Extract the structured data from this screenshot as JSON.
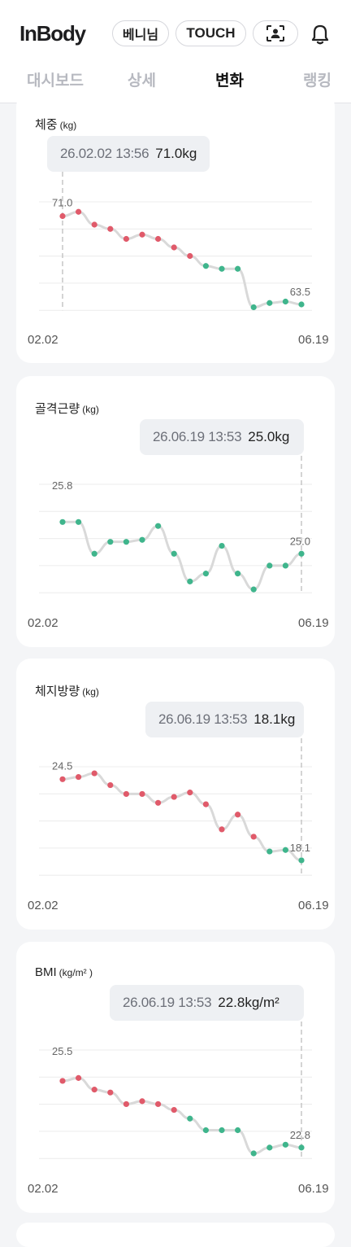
{
  "header": {
    "logo": "InBody",
    "user_label": "베니님",
    "touch_label": "TOUCH",
    "scan_icon": "face-scan-icon",
    "bell_icon": "bell-icon"
  },
  "tabs": [
    {
      "label": "대시보드",
      "active": false
    },
    {
      "label": "상세",
      "active": false
    },
    {
      "label": "변화",
      "active": true
    },
    {
      "label": "랭킹",
      "active": false
    }
  ],
  "colors": {
    "increase": "#e05a6a",
    "decrease": "#3fb58c",
    "line": "#d9d9d9",
    "accent": "#111111"
  },
  "chart_data": [
    {
      "type": "line",
      "title": "체중",
      "unit": "(kg)",
      "x_start": "02.02",
      "x_end": "06.19",
      "tooltip": {
        "date": "26.02.02 13:56",
        "value": "71.0kg"
      },
      "selected_index": 0,
      "label_first": "71.0",
      "label_last": "63.5",
      "ylim": [
        63.4,
        71.0
      ],
      "values": [
        70.0,
        70.3,
        69.4,
        69.1,
        68.4,
        68.7,
        68.4,
        67.8,
        67.2,
        66.5,
        66.3,
        66.3,
        63.6,
        63.9,
        64.0,
        63.8
      ],
      "point_colors": [
        "increase",
        "increase",
        "increase",
        "increase",
        "increase",
        "increase",
        "increase",
        "increase",
        "increase",
        "decrease",
        "decrease",
        "decrease",
        "decrease",
        "decrease",
        "decrease",
        "decrease"
      ]
    },
    {
      "type": "line",
      "title": "골격근량",
      "unit": "(kg)",
      "x_start": "02.02",
      "x_end": "06.19",
      "tooltip": {
        "date": "26.06.19 13:53",
        "value": "25.0kg"
      },
      "selected_index": 15,
      "label_first": "25.8",
      "label_last": "25.0",
      "ylim": [
        24.0,
        25.95
      ],
      "values": [
        25.8,
        25.8,
        25.0,
        25.3,
        25.3,
        25.35,
        25.7,
        25.0,
        24.3,
        24.5,
        25.2,
        24.5,
        24.1,
        24.7,
        24.7,
        25.0
      ],
      "point_colors": [
        "decrease",
        "decrease",
        "decrease",
        "decrease",
        "decrease",
        "decrease",
        "decrease",
        "decrease",
        "decrease",
        "decrease",
        "decrease",
        "decrease",
        "decrease",
        "decrease",
        "decrease",
        "decrease"
      ]
    },
    {
      "type": "line",
      "title": "체지방량",
      "unit": "(kg)",
      "x_start": "02.02",
      "x_end": "06.19",
      "tooltip": {
        "date": "26.06.19 13:53",
        "value": "18.1kg"
      },
      "selected_index": 15,
      "label_first": "24.5",
      "label_last": "18.1",
      "ylim": [
        17.6,
        24.5
      ],
      "values": [
        23.6,
        23.75,
        24.0,
        23.2,
        22.6,
        22.6,
        22.0,
        22.4,
        22.7,
        21.9,
        20.2,
        21.2,
        19.7,
        18.7,
        18.8,
        18.1
      ],
      "point_colors": [
        "increase",
        "increase",
        "increase",
        "increase",
        "increase",
        "increase",
        "increase",
        "increase",
        "increase",
        "increase",
        "increase",
        "increase",
        "increase",
        "decrease",
        "decrease",
        "decrease"
      ]
    },
    {
      "type": "line",
      "title": "BMI",
      "unit": "(kg/m² )",
      "x_start": "02.02",
      "x_end": "06.19",
      "tooltip": {
        "date": "26.06.19 13:53",
        "value": "22.8kg/m²"
      },
      "selected_index": 15,
      "label_first": "25.5",
      "label_last": "22.8",
      "ylim": [
        22.6,
        25.8
      ],
      "values": [
        25.1,
        25.2,
        24.8,
        24.7,
        24.3,
        24.4,
        24.3,
        24.1,
        23.8,
        23.4,
        23.4,
        23.4,
        22.6,
        22.8,
        22.9,
        22.8
      ],
      "point_colors": [
        "increase",
        "increase",
        "increase",
        "increase",
        "increase",
        "increase",
        "increase",
        "increase",
        "decrease",
        "decrease",
        "decrease",
        "decrease",
        "decrease",
        "decrease",
        "decrease",
        "decrease"
      ]
    }
  ]
}
